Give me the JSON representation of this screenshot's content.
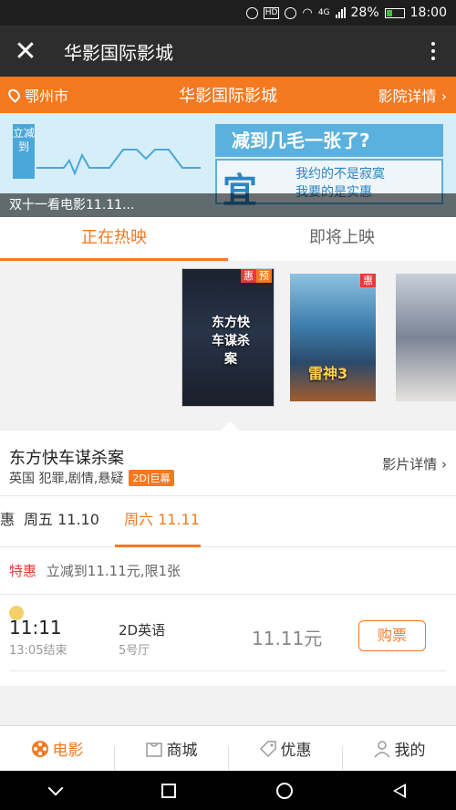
{
  "status_bar": {
    "battery": "28%",
    "time": "18:00",
    "network": "4G"
  },
  "app_bar": {
    "title": "华影国际影城",
    "close_glyph": "✕"
  },
  "location_bar": {
    "city": "鄂州市",
    "cinema": "华影国际影城",
    "detail_link": "影院详情"
  },
  "banner": {
    "badge": "立减到",
    "headline": "减到几毛一张了?",
    "big_char": "宜",
    "line1": "我约的不是寂寞",
    "line2": "我要的是实惠",
    "caption": "双十一看电影11.11..."
  },
  "tabs": [
    {
      "label": "正在热映"
    },
    {
      "label": "即将上映"
    }
  ],
  "posters": [
    {
      "title": "东方快车谋杀案",
      "tags": [
        "惠",
        "预"
      ]
    },
    {
      "title": "雷神3",
      "tags": [
        "惠"
      ]
    },
    {
      "title": "",
      "tags": []
    }
  ],
  "movie": {
    "name": "东方快车谋杀案",
    "meta": "英国 犯罪,剧情,悬疑",
    "format": "2D|巨幕",
    "detail_link": "影片详情"
  },
  "dates": [
    {
      "label": "周五 11.10"
    },
    {
      "label": "周六 11.11",
      "badge": "惠"
    }
  ],
  "promo": {
    "label": "特惠",
    "text": "立减到11.11元,限1张"
  },
  "showtime": {
    "start": "11:11",
    "end": "13:05结束",
    "language": "2D英语",
    "hall": "5号厅",
    "price": "11.11元",
    "buy_label": "购票"
  },
  "bottom_nav": [
    {
      "label": "电影",
      "icon": "film-reel-icon"
    },
    {
      "label": "商城",
      "icon": "shopping-bag-icon"
    },
    {
      "label": "优惠",
      "icon": "coupon-tag-icon"
    },
    {
      "label": "我的",
      "icon": "user-icon"
    }
  ],
  "colors": {
    "accent": "#f47920",
    "badge_red": "#e43b3b",
    "header_dark": "#2d2d2d"
  }
}
